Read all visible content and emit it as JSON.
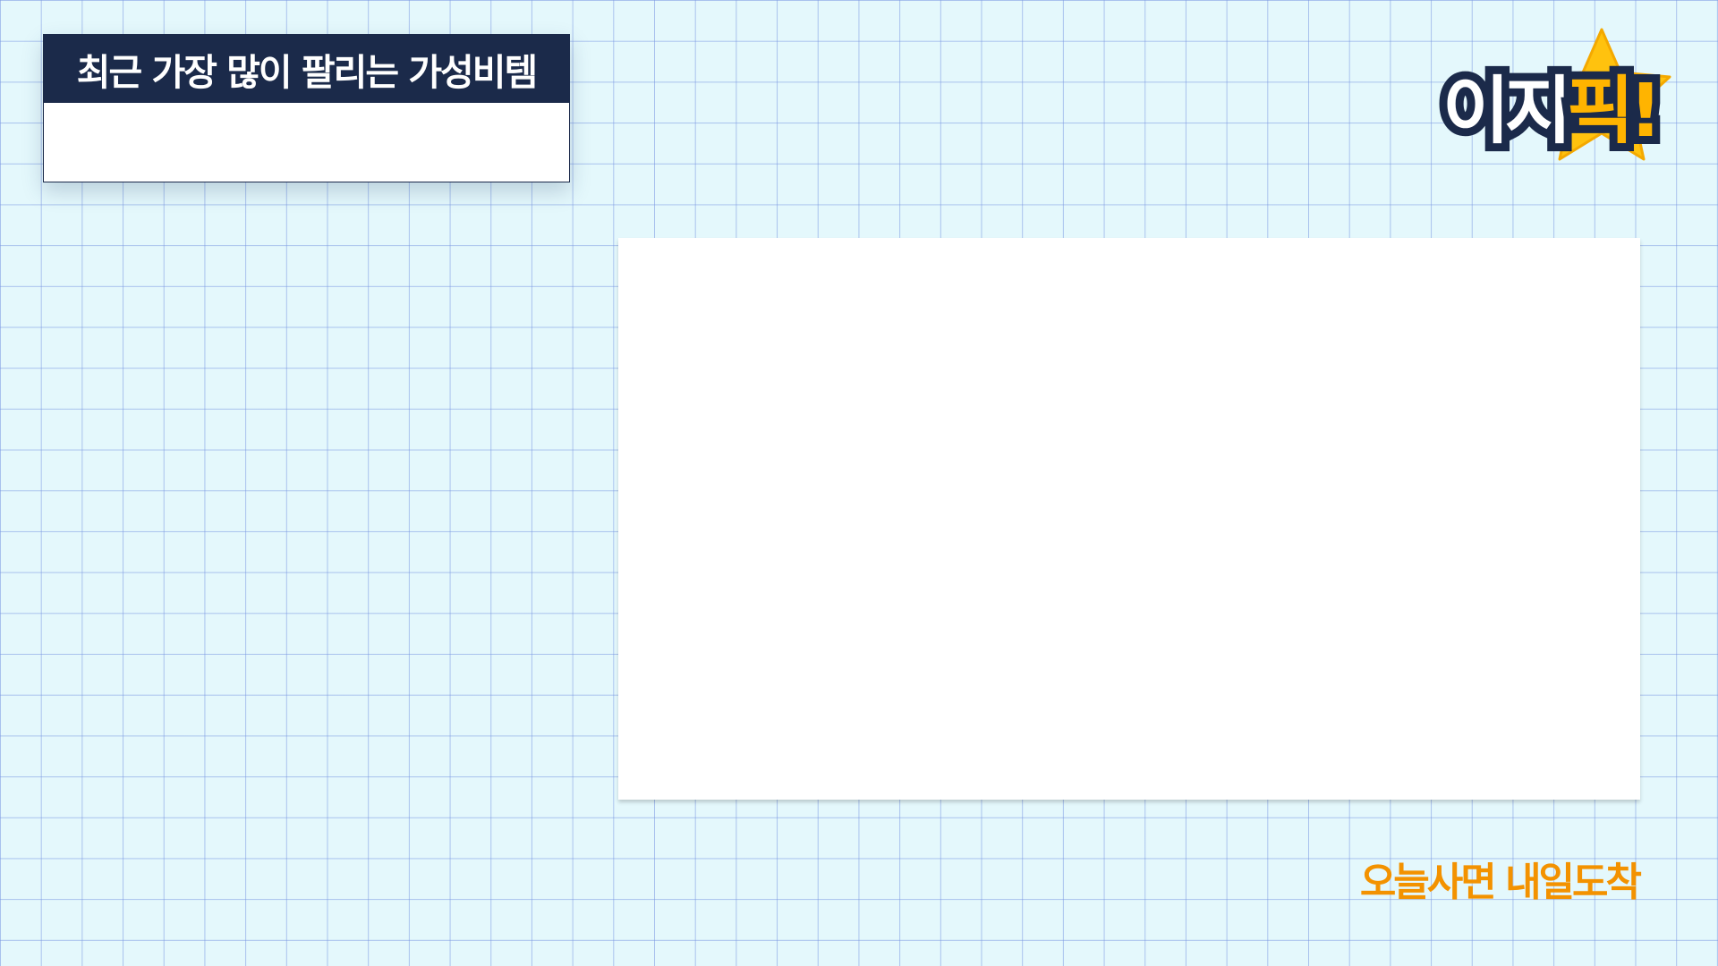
{
  "title_card": {
    "title": "최근 가장 많이 팔리는 가성비템"
  },
  "logo": {
    "text_part_a": "이지",
    "text_part_b": "픽!",
    "icon": "star-icon",
    "colors": {
      "outline": "#1b2a4a",
      "star": "#ffc20e",
      "accent_text": "#ffb400"
    }
  },
  "tagline": {
    "text": "오늘사면 내일도착"
  },
  "colors": {
    "background": "#e4f8fc",
    "grid_line": "#7896e1",
    "header_bar": "#1b2a4a",
    "tagline": "#f39200",
    "panel": "#ffffff"
  }
}
